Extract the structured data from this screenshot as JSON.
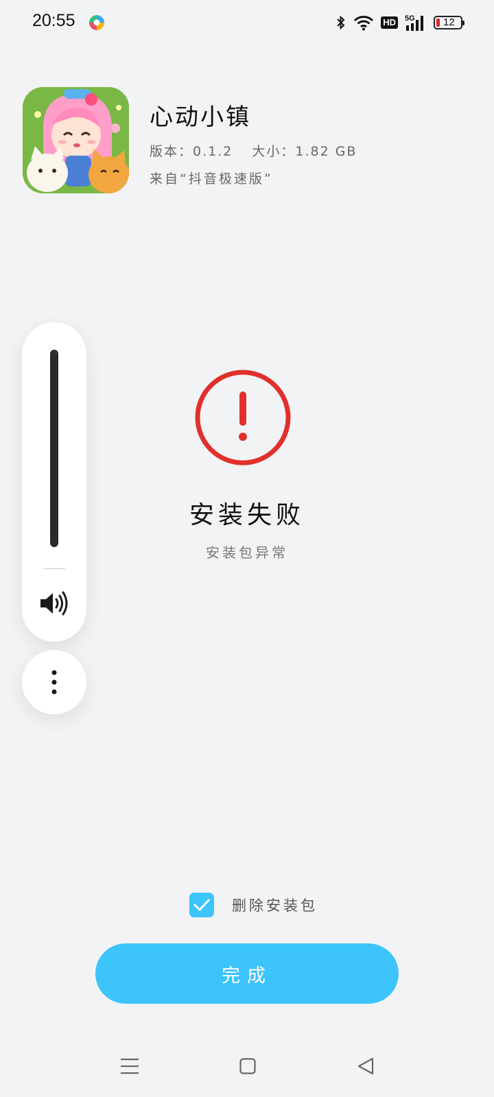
{
  "status_bar": {
    "time": "20:55",
    "network": "5G",
    "hd_label": "HD",
    "battery_level": "12",
    "icons": [
      "notification-app-icon",
      "bluetooth-icon",
      "wifi-icon",
      "hd-icon",
      "signal-5g-icon",
      "battery-icon"
    ]
  },
  "app": {
    "name": "心动小镇",
    "version": "版本：0.1.2",
    "size": "大小：1.82 GB",
    "source": "来自“抖音极速版”",
    "icon": "app-icon"
  },
  "volume_panel": {
    "level": 1.0,
    "icons": [
      "speaker-icon",
      "more-vertical-icon"
    ]
  },
  "result": {
    "icon": "error-exclamation-icon",
    "title": "安装失败",
    "subtitle": "安装包异常"
  },
  "delete_option": {
    "label": "删除安装包",
    "checked": true
  },
  "done_button": {
    "label": "完成"
  },
  "colors": {
    "background": "#f2f3f5",
    "accent": "#3dc4fb",
    "error": "#e1302b"
  },
  "nav_bar": {
    "icons": [
      "menu-icon",
      "home-icon",
      "back-icon"
    ]
  }
}
